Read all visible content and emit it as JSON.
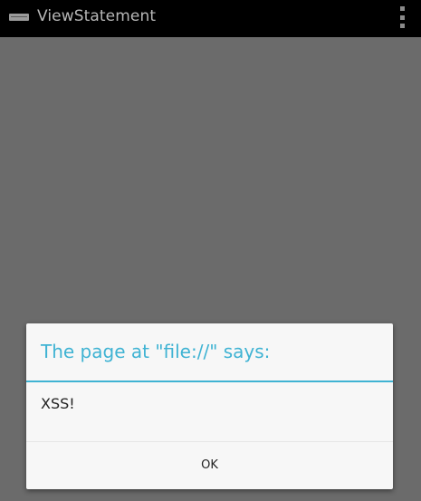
{
  "action_bar": {
    "title": "ViewStatement",
    "app_icon": "app-icon",
    "overflow_icon": "overflow-menu-icon"
  },
  "dialog": {
    "title": "The page at \"file://\" says:",
    "message": "XSS!",
    "ok_label": "OK"
  },
  "colors": {
    "action_bar_bg": "#000000",
    "dim_background": "#6b6b6b",
    "dialog_bg": "#f7f7f7",
    "accent": "#3fb3d3",
    "text": "#222222"
  }
}
